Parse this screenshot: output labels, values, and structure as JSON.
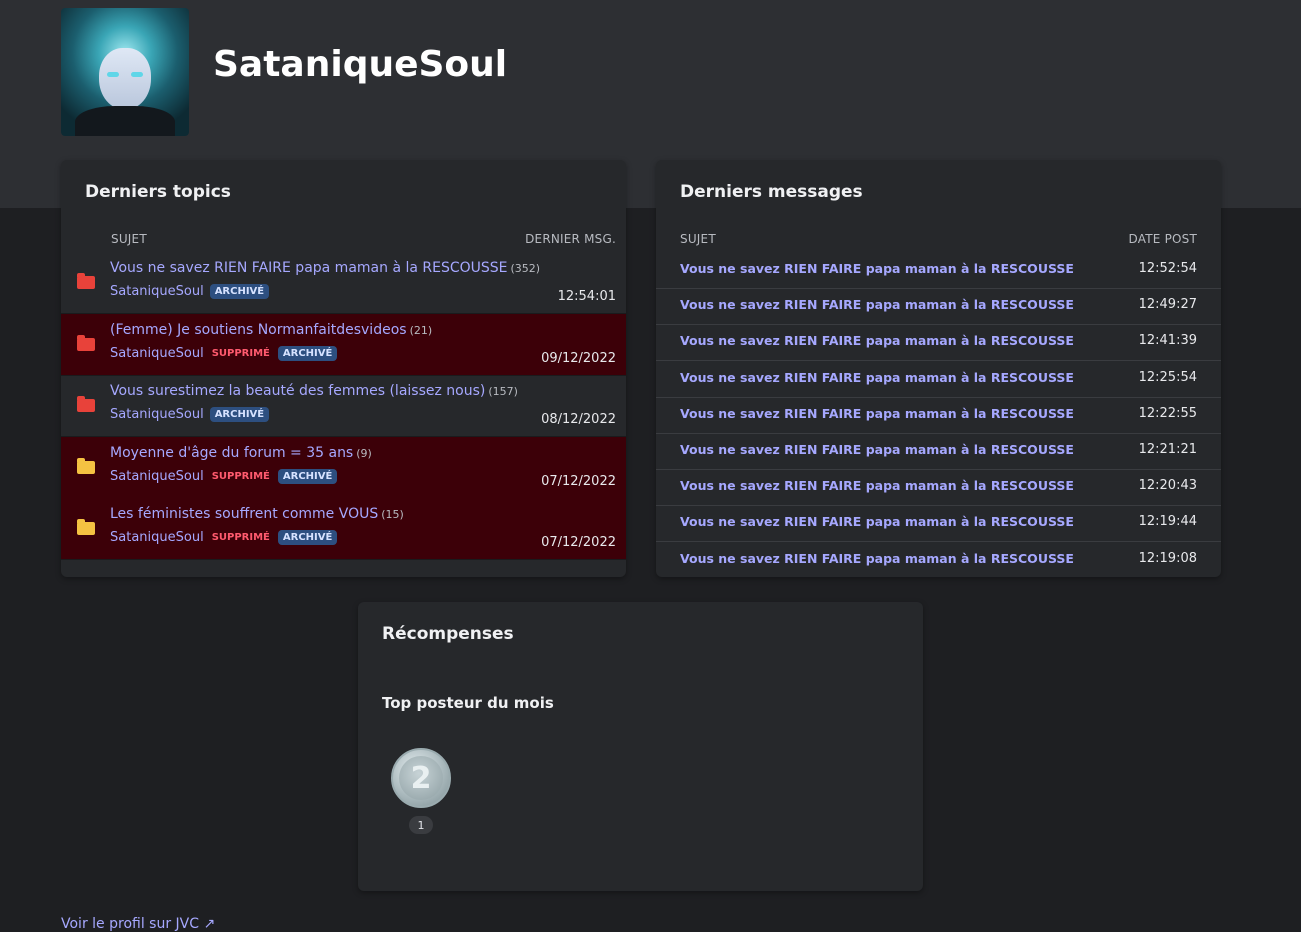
{
  "profile": {
    "username": "SataniqueSoul"
  },
  "topics": {
    "title": "Derniers topics",
    "col_subject": "SUJET",
    "col_last": "DERNIER MSG.",
    "rows": [
      {
        "title": "Vous ne savez RIEN FAIRE papa maman à la RESCOUSSE",
        "count": "(352)",
        "author": "SataniqueSoul",
        "deleted_label": "",
        "archived_label": "ARCHIVÉ",
        "date": "12:54:01",
        "deleted": false,
        "folder_color": "#e8423a"
      },
      {
        "title": "(Femme) Je soutiens Normanfaitdesvideos",
        "count": "(21)",
        "author": "SataniqueSoul",
        "deleted_label": "SUPPRIMÉ",
        "archived_label": "ARCHIVÉ",
        "date": "09/12/2022",
        "deleted": true,
        "folder_color": "#e8423a"
      },
      {
        "title": "Vous surestimez la beauté des femmes (laissez nous)",
        "count": "(157)",
        "author": "SataniqueSoul",
        "deleted_label": "",
        "archived_label": "ARCHIVÉ",
        "date": "08/12/2022",
        "deleted": false,
        "folder_color": "#e8423a"
      },
      {
        "title": "Moyenne d'âge du forum = 35 ans",
        "count": "(9)",
        "author": "SataniqueSoul",
        "deleted_label": "SUPPRIMÉ",
        "archived_label": "ARCHIVÉ",
        "date": "07/12/2022",
        "deleted": true,
        "folder_color": "#f5c242"
      },
      {
        "title": "Les féministes souffrent comme VOUS",
        "count": "(15)",
        "author": "SataniqueSoul",
        "deleted_label": "SUPPRIMÉ",
        "archived_label": "ARCHIVÉ",
        "date": "07/12/2022",
        "deleted": true,
        "folder_color": "#f5c242"
      }
    ]
  },
  "messages": {
    "title": "Derniers messages",
    "col_subject": "SUJET",
    "col_date": "DATE POST",
    "rows": [
      {
        "title": "Vous ne savez RIEN FAIRE papa maman à la RESCOUSSE",
        "time": "12:52:54"
      },
      {
        "title": "Vous ne savez RIEN FAIRE papa maman à la RESCOUSSE",
        "time": "12:49:27"
      },
      {
        "title": "Vous ne savez RIEN FAIRE papa maman à la RESCOUSSE",
        "time": "12:41:39"
      },
      {
        "title": "Vous ne savez RIEN FAIRE papa maman à la RESCOUSSE",
        "time": "12:25:54"
      },
      {
        "title": "Vous ne savez RIEN FAIRE papa maman à la RESCOUSSE",
        "time": "12:22:55"
      },
      {
        "title": "Vous ne savez RIEN FAIRE papa maman à la RESCOUSSE",
        "time": "12:21:21"
      },
      {
        "title": "Vous ne savez RIEN FAIRE papa maman à la RESCOUSSE",
        "time": "12:20:43"
      },
      {
        "title": "Vous ne savez RIEN FAIRE papa maman à la RESCOUSSE",
        "time": "12:19:44"
      },
      {
        "title": "Vous ne savez RIEN FAIRE papa maman à la RESCOUSSE",
        "time": "12:19:08"
      }
    ]
  },
  "rewards": {
    "title": "Récompenses",
    "subtitle": "Top posteur du mois",
    "medal_rank": "2",
    "medal_count": "1"
  },
  "footer": {
    "link_label": "Voir le profil sur JVC",
    "link_icon": "external-link-icon"
  },
  "colors": {
    "link": "#a6a8ff",
    "deleted_row": "#3c0008",
    "archived_badge": "#2d4f80",
    "deleted_badge": "#ff5a6e"
  }
}
